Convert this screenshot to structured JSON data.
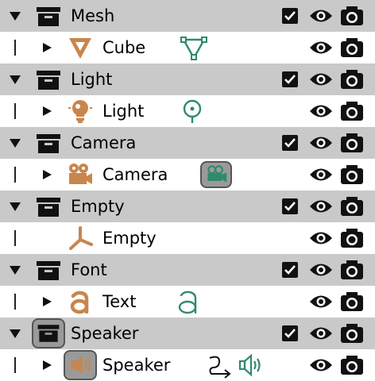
{
  "outliner": {
    "rows": [
      {
        "kind": "collection",
        "label": "Mesh",
        "checked": true,
        "icon": "collection-box-icon"
      },
      {
        "kind": "object",
        "label": "Cube",
        "object_icon": "mesh-cone-icon",
        "data_icon": "mesh-data-icon"
      },
      {
        "kind": "collection",
        "label": "Light",
        "checked": true,
        "icon": "collection-box-icon"
      },
      {
        "kind": "object",
        "label": "Light",
        "object_icon": "light-bulb-icon",
        "data_icon": "light-data-icon"
      },
      {
        "kind": "collection",
        "label": "Camera",
        "checked": true,
        "icon": "collection-box-icon"
      },
      {
        "kind": "object",
        "label": "Camera",
        "object_icon": "camera-object-icon",
        "data_icon": "camera-data-icon"
      },
      {
        "kind": "collection",
        "label": "Empty",
        "checked": true,
        "icon": "collection-box-icon"
      },
      {
        "kind": "object",
        "label": "Empty",
        "object_icon": "empty-axes-icon"
      },
      {
        "kind": "collection",
        "label": "Font",
        "checked": true,
        "icon": "collection-box-icon"
      },
      {
        "kind": "object",
        "label": "Text",
        "object_icon": "font-a-icon",
        "data_icon": "font-data-icon"
      },
      {
        "kind": "collection",
        "label": "Speaker",
        "checked": true,
        "icon": "collection-box-icon"
      },
      {
        "kind": "object",
        "label": "Speaker",
        "object_icon": "speaker-object-icon",
        "data_icon": "speaker-data-icon"
      }
    ]
  },
  "colors": {
    "collection_row_bg": "#c9c9c9",
    "object_icon_orange": "#c8864d",
    "data_icon_green": "#2f8a6e"
  }
}
